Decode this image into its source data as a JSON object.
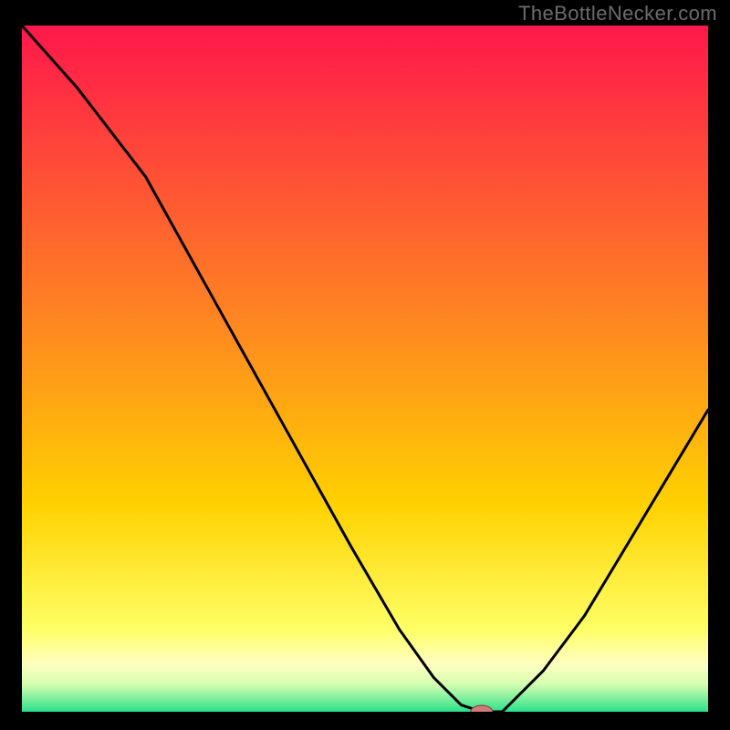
{
  "watermark": "TheBottleNecker.com",
  "chart_data": {
    "type": "line",
    "title": "",
    "xlabel": "",
    "ylabel": "",
    "xlim": [
      0,
      100
    ],
    "ylim": [
      0,
      100
    ],
    "grid": false,
    "legend": false,
    "series": [
      {
        "name": "bottleneck-curve",
        "x": [
          0,
          8,
          18,
          28,
          38,
          48,
          55,
          60,
          64,
          67,
          70,
          76,
          82,
          88,
          94,
          100
        ],
        "y": [
          100,
          91,
          78,
          60,
          42,
          24,
          12,
          5,
          1,
          0,
          0,
          6,
          14,
          24,
          34,
          44
        ]
      }
    ],
    "marker": {
      "name": "optimal-point",
      "x": 67,
      "y": 0,
      "color": "#d17a7a",
      "rx": 12,
      "ry": 7
    },
    "background_gradient": {
      "top_color": "#ff174b",
      "mid_color": "#ffd200",
      "pale_color": "#ffffa6",
      "bottom_color": "#2ce08b"
    }
  }
}
